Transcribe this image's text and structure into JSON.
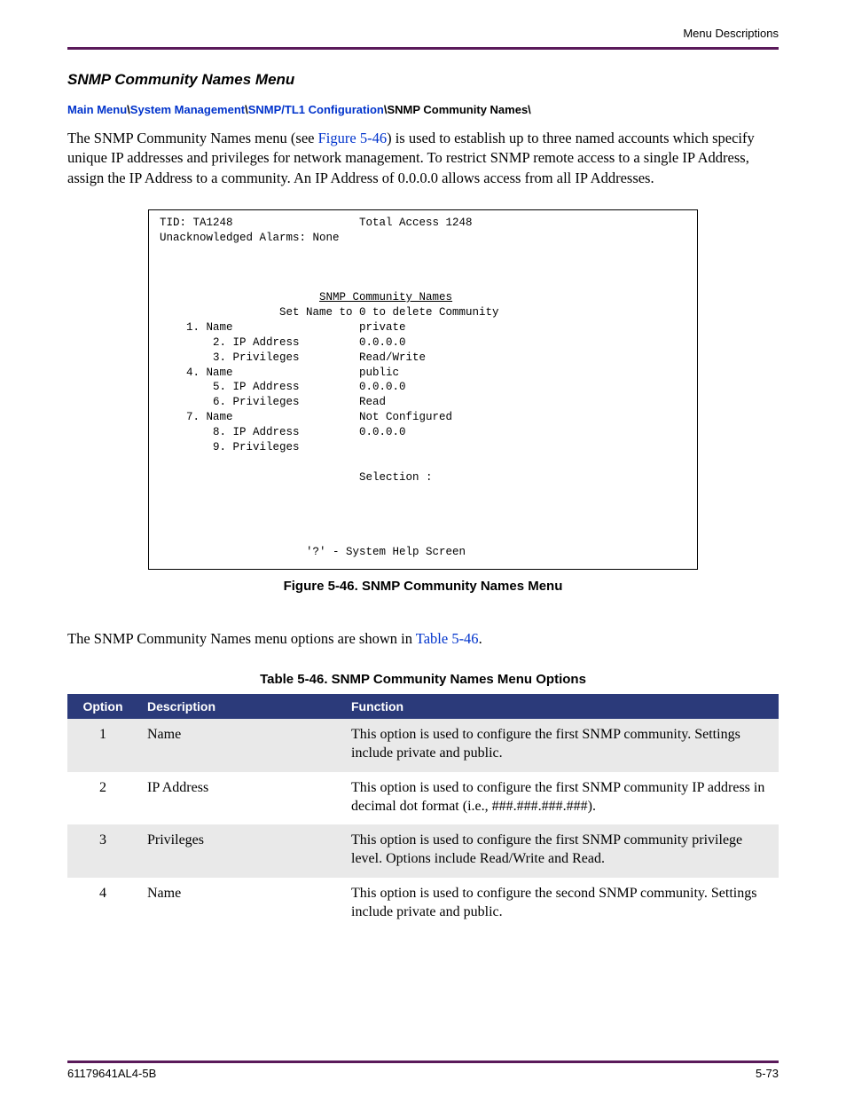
{
  "header": {
    "right": "Menu Descriptions"
  },
  "section_title": "SNMP Community Names Menu",
  "breadcrumb": {
    "links": [
      "Main Menu",
      "System Management",
      "SNMP/TL1 Configuration"
    ],
    "tail": "SNMP Community Names\\"
  },
  "para1": {
    "pre": "The SNMP Community Names menu (see ",
    "ref": "Figure 5-46",
    "post": ") is used to establish up to three named accounts which specify unique IP addresses and privileges for network management. To restrict SNMP remote access to a single IP Address, assign the IP Address to a community. An IP Address of 0.0.0.0 allows access from all IP Addresses."
  },
  "terminal": {
    "tid": "TID: TA1248",
    "title": "Total Access 1248",
    "alarms": "Unacknowledged Alarms: None",
    "heading": "SNMP Community Names",
    "subheading": "Set Name to 0 to delete Community",
    "rows": [
      {
        "key": "1. Name",
        "val": "private",
        "indent": 0
      },
      {
        "key": "2. IP Address",
        "val": "0.0.0.0",
        "indent": 1
      },
      {
        "key": "3. Privileges",
        "val": "Read/Write",
        "indent": 1
      },
      {
        "key": "4. Name",
        "val": "public",
        "indent": 0
      },
      {
        "key": "5. IP Address",
        "val": "0.0.0.0",
        "indent": 1
      },
      {
        "key": "6. Privileges",
        "val": "Read",
        "indent": 1
      },
      {
        "key": "7. Name",
        "val": "Not Configured",
        "indent": 0
      },
      {
        "key": "8. IP Address",
        "val": "0.0.0.0",
        "indent": 1
      },
      {
        "key": "9. Privileges",
        "val": "",
        "indent": 1
      }
    ],
    "selection": "Selection :",
    "help": "'?' - System Help Screen"
  },
  "figure_caption": "Figure 5-46.  SNMP Community Names Menu",
  "para2": {
    "pre": "The SNMP Community Names menu options are shown in ",
    "ref": "Table 5-46",
    "post": "."
  },
  "table_caption": "Table 5-46.  SNMP Community Names Menu Options",
  "table": {
    "headers": {
      "option": "Option",
      "description": "Description",
      "function": "Function"
    },
    "rows": [
      {
        "option": "1",
        "description": "Name",
        "function": "This option is used to configure the first SNMP community. Settings include private and public."
      },
      {
        "option": "2",
        "description": "IP Address",
        "function": "This option is used to configure the first SNMP community IP address in decimal dot format (i.e., ###.###.###.###)."
      },
      {
        "option": "3",
        "description": "Privileges",
        "function": "This option is used to configure the first SNMP community privilege level. Options include Read/Write and Read."
      },
      {
        "option": "4",
        "description": "Name",
        "function": "This option is used to configure the second SNMP community. Settings include private and public."
      }
    ]
  },
  "footer": {
    "left": "61179641AL4-5B",
    "right": "5-73"
  }
}
